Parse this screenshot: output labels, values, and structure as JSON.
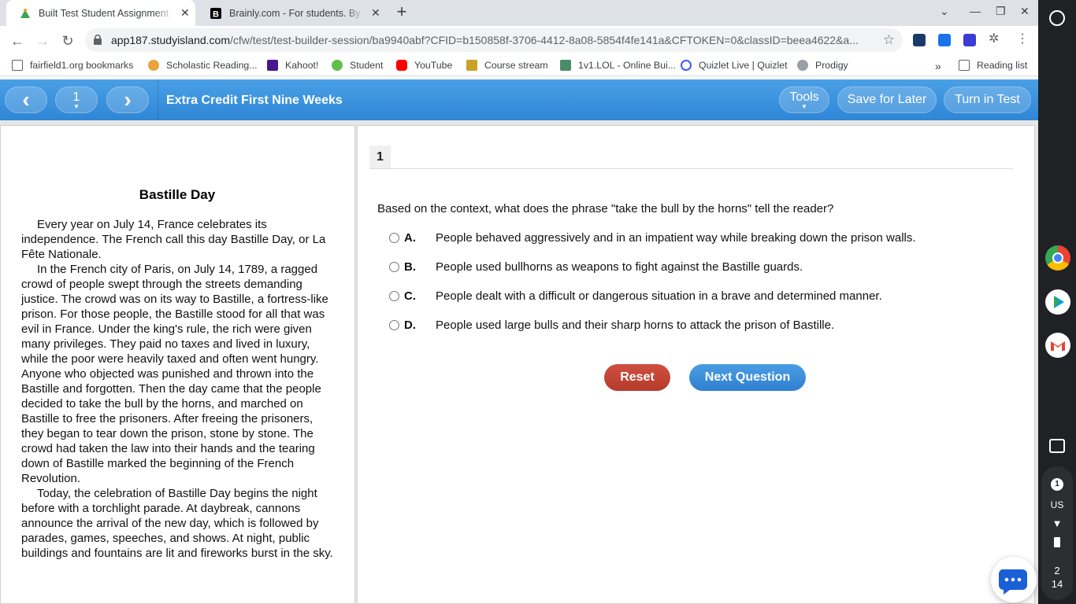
{
  "browser": {
    "tabs": [
      {
        "title": "Built Test Student Assignment - S",
        "close": "✕"
      },
      {
        "title": "Brainly.com - For students. By stu",
        "close": "✕"
      }
    ],
    "url_main": "app187.studyisland.com",
    "url_rest": "/cfw/test/test-builder-session/ba9940abf?CFID=b150858f-3706-4412-8a08-5854f4fe141a&CFTOKEN=0&classID=beea4622&a...",
    "bookmarks": [
      "fairfield1.org bookmarks",
      "Scholastic Reading...",
      "Kahoot!",
      "Student",
      "YouTube",
      "Course stream",
      "1v1.LOL - Online Bui...",
      "Quizlet Live | Quizlet",
      "Prodigy"
    ],
    "more_bookmarks": "»",
    "reading_list": "Reading list"
  },
  "header": {
    "prev": "‹",
    "page": "1",
    "next": "›",
    "title": "Extra Credit First Nine Weeks",
    "tools": "Tools",
    "save": "Save for Later",
    "turn_in": "Turn in Test"
  },
  "passage": {
    "title": "Bastille Day",
    "paragraphs": [
      "Every year on July 14, France celebrates its independence. The French call this day Bastille Day, or La Fête Nationale.",
      "In the French city of Paris, on July 14, 1789, a ragged crowd of people swept through the streets demanding justice. The crowd was on its way to Bastille, a fortress-like prison. For those people, the Bastille stood for all that was evil in France. Under the king's rule, the rich were given many privileges. They paid no taxes and lived in luxury, while the poor were heavily taxed and often went hungry. Anyone who objected was punished and thrown into the Bastille and forgotten. Then the day came that the people decided to take the bull by the horns, and marched on Bastille to free the prisoners. After freeing the prisoners, they began to tear down the prison, stone by stone. The crowd had taken the law into their hands and the tearing down of Bastille marked the beginning of the French Revolution.",
      "Today, the celebration of Bastille Day begins the night before with a torchlight parade. At daybreak, cannons announce the arrival of the new day, which is followed by parades, games, speeches, and shows. At night, public buildings and fountains are lit and fireworks burst in the sky."
    ]
  },
  "question": {
    "number": "1",
    "text": "Based on the context, what does the phrase \"take the bull by the horns\" tell the reader?",
    "choices": [
      {
        "letter": "A.",
        "text": "People behaved aggressively and in an impatient way while breaking down the prison walls."
      },
      {
        "letter": "B.",
        "text": "People used bullhorns as weapons to fight against the Bastille guards."
      },
      {
        "letter": "C.",
        "text": "People dealt with a difficult or dangerous situation in a brave and determined manner."
      },
      {
        "letter": "D.",
        "text": "People used large bulls and their sharp horns to attack the prison of Bastille."
      }
    ],
    "reset": "Reset",
    "next": "Next Question"
  },
  "shelf": {
    "notifications": "1",
    "ime": "US",
    "time_h": "2",
    "time_m": "14"
  },
  "colors": {
    "header_blue": "#2f86d6",
    "reset_red": "#c0392b",
    "next_blue": "#3a8ed8"
  }
}
